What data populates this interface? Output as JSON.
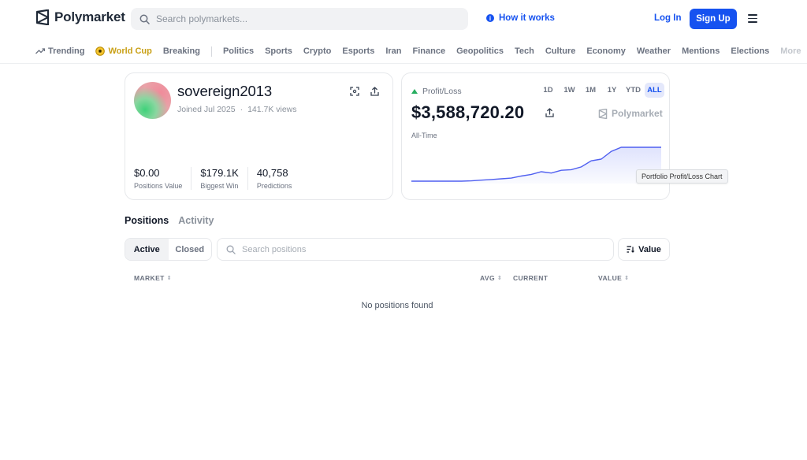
{
  "header": {
    "logo_text": "Polymarket",
    "search_placeholder": "Search polymarkets...",
    "how_it_works": "How it works",
    "login": "Log In",
    "signup": "Sign Up"
  },
  "nav": {
    "items": [
      "Trending",
      "World Cup",
      "Breaking",
      "Politics",
      "Sports",
      "Crypto",
      "Esports",
      "Iran",
      "Finance",
      "Geopolitics",
      "Tech",
      "Culture",
      "Economy",
      "Weather",
      "Mentions",
      "Elections"
    ],
    "more": "More"
  },
  "profile": {
    "username": "sovereign2013",
    "joined": "Joined Jul 2025",
    "separator": "·",
    "views": "141.7K views",
    "stats": [
      {
        "value": "$0.00",
        "label": "Positions Value"
      },
      {
        "value": "$179.1K",
        "label": "Biggest Win"
      },
      {
        "value": "40,758",
        "label": "Predictions"
      }
    ]
  },
  "pnl": {
    "title": "Profit/Loss",
    "ranges": [
      "1D",
      "1W",
      "1M",
      "1Y",
      "YTD",
      "ALL"
    ],
    "active_range": "ALL",
    "value": "$3,588,720.20",
    "brand": "Polymarket",
    "period": "All-Time",
    "tooltip": "Portfolio Profit/Loss Chart",
    "colors": {
      "line": "#4f5ff0",
      "area": "#dfe3fd",
      "up": "#27ae60"
    }
  },
  "chart_data": {
    "type": "area",
    "values": [
      0,
      0,
      0,
      0,
      0,
      0,
      0.01,
      0.03,
      0.05,
      0.07,
      0.09,
      0.15,
      0.2,
      0.28,
      0.24,
      0.32,
      0.34,
      0.42,
      0.6,
      0.65,
      0.88,
      1,
      1,
      1,
      1,
      1
    ],
    "ylim": [
      0,
      1
    ]
  },
  "positions": {
    "tabs": [
      "Positions",
      "Activity"
    ],
    "filter_active": "Active",
    "filter_closed": "Closed",
    "search_placeholder": "Search positions",
    "sort_label": "Value",
    "columns": {
      "market": "MARKET",
      "avg": "AVG",
      "current": "CURRENT",
      "value": "VALUE"
    },
    "empty": "No positions found"
  }
}
